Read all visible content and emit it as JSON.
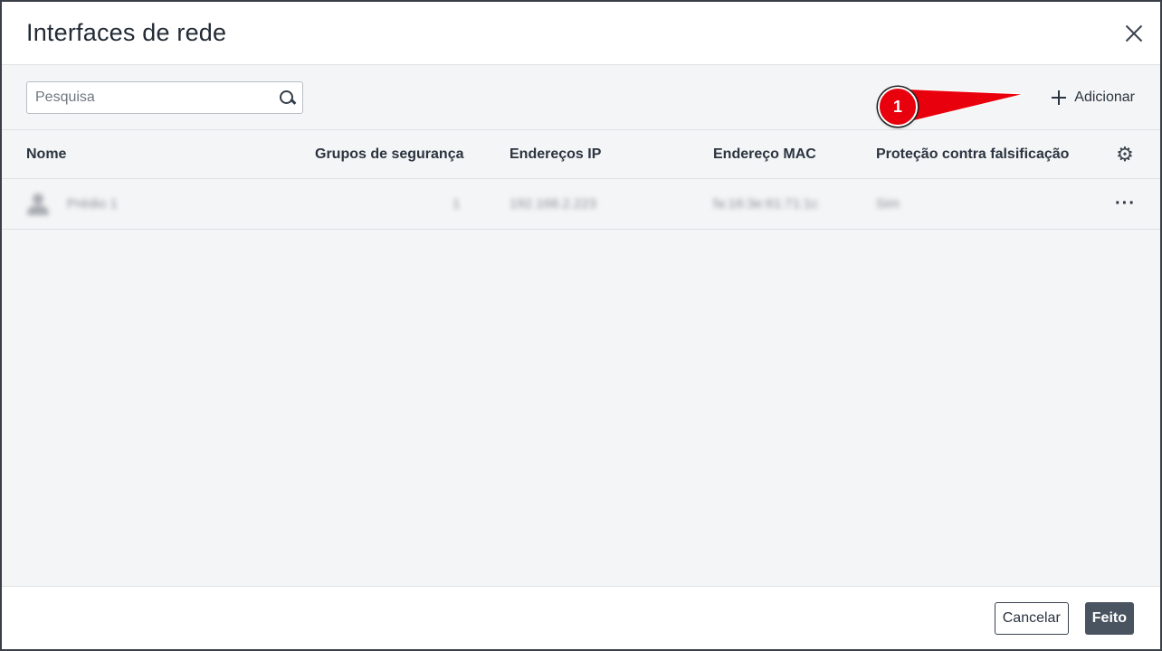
{
  "dialog": {
    "title": "Interfaces de rede",
    "close_icon": "close-icon"
  },
  "toolbar": {
    "search_placeholder": "Pesquisa",
    "search_icon": "search-icon",
    "add_label": "Adicionar",
    "add_icon": "plus-icon"
  },
  "annotation": {
    "badge_label": "1",
    "color": "#e8000d"
  },
  "table": {
    "columns": {
      "name": "Nome",
      "groups": "Grupos de segurança",
      "ip": "Endereços IP",
      "mac": "Endereço MAC",
      "spoof": "Proteção contra falsificação"
    },
    "settings_icon": "gear-icon",
    "rows": [
      {
        "name": "Prédio 1",
        "groups": "1",
        "ip": "192.168.2.223",
        "mac": "fa:16:3e:61:71:1c",
        "spoof": "Sim",
        "icon": "user-icon",
        "actions_icon": "more-icon"
      }
    ]
  },
  "footer": {
    "cancel_label": "Cancelar",
    "done_label": "Feito"
  },
  "colors": {
    "primary_button": "#4a5461",
    "background": "#f4f5f6",
    "annotation_red": "#e8000d"
  }
}
